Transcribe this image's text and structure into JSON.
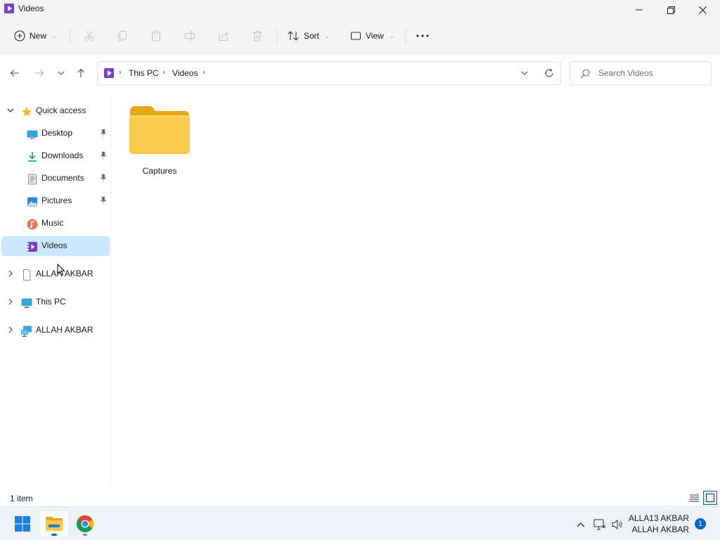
{
  "window": {
    "title": "Videos",
    "icons": {
      "app": "videos-icon",
      "minimize": "minimize-icon",
      "maximize": "maximize-icon",
      "close": "close-icon"
    }
  },
  "toolbar": {
    "new_label": "New",
    "sort_label": "Sort",
    "view_label": "View",
    "icons": [
      "cut-icon",
      "copy-icon",
      "paste-icon",
      "rename-icon",
      "share-icon",
      "delete-icon",
      "more-icon"
    ]
  },
  "address": {
    "crumbs": [
      "This PC",
      "Videos"
    ],
    "search_placeholder": "Search Videos"
  },
  "sidebar": {
    "quick_access_label": "Quick access",
    "quick_items": [
      {
        "label": "Desktop",
        "icon": "desktop-icon",
        "pinned": true
      },
      {
        "label": "Downloads",
        "icon": "downloads-icon",
        "pinned": true
      },
      {
        "label": "Documents",
        "icon": "documents-icon",
        "pinned": true
      },
      {
        "label": "Pictures",
        "icon": "pictures-icon",
        "pinned": true
      },
      {
        "label": "Music",
        "icon": "music-icon",
        "pinned": false
      },
      {
        "label": "Videos",
        "icon": "videos-icon",
        "pinned": false,
        "selected": true
      }
    ],
    "roots": [
      {
        "label": "ALLAH AKBAR",
        "icon": "drive-icon"
      },
      {
        "label": "This PC",
        "icon": "this-pc-icon"
      },
      {
        "label": "ALLAH AKBAR",
        "icon": "network-icon"
      }
    ]
  },
  "content": {
    "items": [
      {
        "label": "Captures",
        "type": "folder"
      }
    ]
  },
  "status": {
    "count": "1 item"
  },
  "taskbar": {
    "apps": [
      "start-icon",
      "file-explorer-icon",
      "chrome-icon"
    ],
    "clock_line1": "ALLA13 AKBAR",
    "clock_line2": "ALLAH AKBAR",
    "notification_count": "1"
  },
  "colors": {
    "accent": "#0067c0",
    "selection": "#cce8ff",
    "folder": "#f8c94a",
    "videos": "#7a3fc4"
  }
}
